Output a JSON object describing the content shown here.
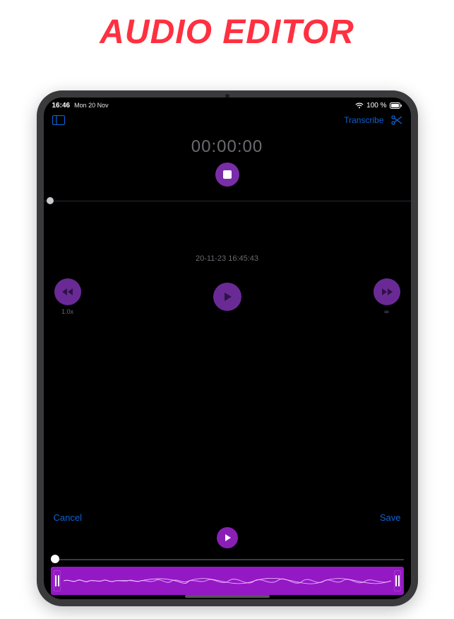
{
  "headline": "AUDIO EDITOR",
  "status": {
    "time": "16:46",
    "date": "Mon 20 Nov",
    "battery_pct": "100 %"
  },
  "nav": {
    "transcribe_label": "Transcribe"
  },
  "timer": {
    "value": "00:00:00"
  },
  "recording": {
    "name": "20-11-23 16:45:43"
  },
  "transport": {
    "speed_label": "1.0x",
    "loop_label": "∞"
  },
  "editor": {
    "cancel_label": "Cancel",
    "save_label": "Save"
  },
  "colors": {
    "accent_purple": "#7a2da8",
    "bright_purple": "#9418c4",
    "link_blue": "#0b63d6",
    "headline_red": "#ff3040"
  }
}
